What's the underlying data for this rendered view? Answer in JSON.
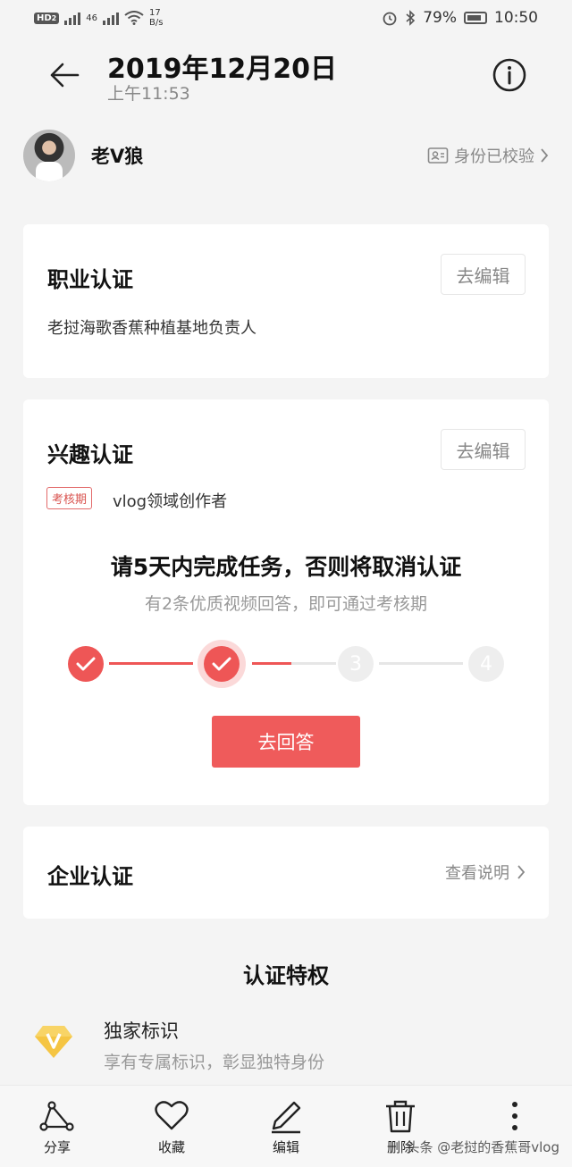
{
  "status_bar": {
    "hd_label": "HD",
    "hd_sub": "2",
    "network_rate": "17",
    "network_unit": "B/s",
    "net_type": "46",
    "battery": "79%",
    "time": "10:50"
  },
  "header": {
    "date": "2019年12月20日",
    "time": "上午11:53"
  },
  "user": {
    "name": "老V狼",
    "verify_label": "身份已校验"
  },
  "job_card": {
    "title": "职业认证",
    "edit_label": "去编辑",
    "description": "老挝海歌香蕉种植基地负责人"
  },
  "interest_card": {
    "title": "兴趣认证",
    "edit_label": "去编辑",
    "tag": "考核期",
    "tag_text": "vlog领域创作者",
    "task_heading": "请5天内完成任务，否则将取消认证",
    "task_sub": "有2条优质视频回答，即可通过考核期",
    "steps": [
      "",
      "",
      "3",
      "4"
    ],
    "progress_step": 2,
    "answer_button": "去回答"
  },
  "enterprise_card": {
    "title": "企业认证",
    "explain_label": "查看说明"
  },
  "privileges": {
    "title": "认证特权",
    "items": [
      {
        "name": "独家标识",
        "desc": "享有专属标识，彰显独特身份",
        "icon": "diamond-v-icon"
      }
    ]
  },
  "bottom_bar": {
    "share": "分享",
    "favorite": "收藏",
    "edit": "编辑",
    "delete": "删除",
    "watermark": "头条 @老挝的香蕉哥vlog"
  },
  "colors": {
    "accent": "#ef5b5b",
    "background": "#f4f4f4",
    "card": "#ffffff"
  }
}
